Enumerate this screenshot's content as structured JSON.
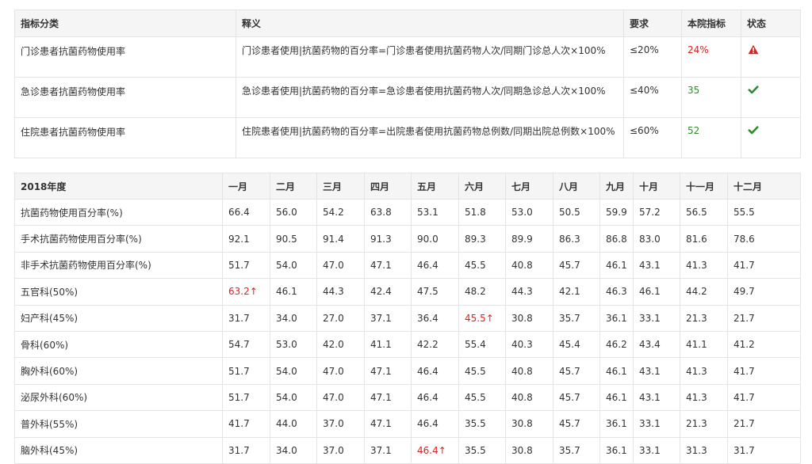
{
  "indicators": {
    "headers": {
      "category": "指标分类",
      "definition": "释义",
      "requirement": "要求",
      "value": "本院指标",
      "status": "状态"
    },
    "rows": [
      {
        "category": "门诊患者抗菌药物使用率",
        "definition": "门诊患者使用|抗菌药物的百分率=门诊患者使用抗菌药物人次/同期门诊总人次×100%",
        "requirement": "≤20%",
        "value": "24%",
        "value_color": "#e02020",
        "status_icon": "warning-icon"
      },
      {
        "category": "急诊患者抗菌药物使用率",
        "definition": "急诊患者使用|抗菌药物的百分率=急诊患者使用抗菌药物人次/同期急诊总人次×100%",
        "requirement": "≤40%",
        "value": "35",
        "value_color": "#2e8b2e",
        "status_icon": "checkmark-icon"
      },
      {
        "category": "住院患者抗菌药物使用率",
        "definition": "住院患者使用|抗菌药物的百分率=出院患者使用抗菌药物总例数/同期出院总例数×100%",
        "requirement": "≤60%",
        "value": "52",
        "value_color": "#2e8b2e",
        "status_icon": "checkmark-icon"
      }
    ]
  },
  "monthly": {
    "year_header": "2018年度",
    "months": [
      "一月",
      "二月",
      "三月",
      "四月",
      "五月",
      "六月",
      "七月",
      "八月",
      "九月",
      "十月",
      "十一月",
      "十二月"
    ],
    "rows": [
      {
        "label": "抗菌药物使用百分率(%)",
        "values": [
          "66.4",
          "56.0",
          "54.2",
          "63.8",
          "53.1",
          "51.8",
          "53.0",
          "50.5",
          "59.9",
          "57.2",
          "56.5",
          "55.5"
        ],
        "alerts": []
      },
      {
        "label": "手术抗菌药物使用百分率(%)",
        "values": [
          "92.1",
          "90.5",
          "91.4",
          "91.3",
          "90.0",
          "89.3",
          "89.9",
          "86.3",
          "86.8",
          "83.0",
          "81.6",
          "78.6"
        ],
        "alerts": []
      },
      {
        "label": "非手术抗菌药物使用百分率(%)",
        "values": [
          "51.7",
          "54.0",
          "47.0",
          "47.1",
          "46.4",
          "45.5",
          "40.8",
          "45.7",
          "46.1",
          "43.1",
          "41.3",
          "41.7"
        ],
        "alerts": []
      },
      {
        "label": "五官科(50%)",
        "values": [
          "63.2↑",
          "46.1",
          "44.3",
          "42.4",
          "47.5",
          "48.2",
          "44.3",
          "42.1",
          "46.3",
          "46.1",
          "44.2",
          "49.7"
        ],
        "alerts": [
          0
        ]
      },
      {
        "label": "妇产科(45%)",
        "values": [
          "31.7",
          "34.0",
          "27.0",
          "37.1",
          "36.4",
          "45.5↑",
          "30.8",
          "35.7",
          "36.1",
          "33.1",
          "21.3",
          "21.7"
        ],
        "alerts": [
          5
        ]
      },
      {
        "label": "骨科(60%)",
        "values": [
          "54.7",
          "53.0",
          "42.0",
          "41.1",
          "42.2",
          "55.4",
          "40.3",
          "45.4",
          "46.2",
          "43.4",
          "41.1",
          "41.2"
        ],
        "alerts": []
      },
      {
        "label": "胸外科(60%)",
        "values": [
          "51.7",
          "54.0",
          "47.0",
          "47.1",
          "46.4",
          "45.5",
          "40.8",
          "45.7",
          "46.1",
          "43.1",
          "41.3",
          "41.7"
        ],
        "alerts": []
      },
      {
        "label": "泌尿外科(60%)",
        "values": [
          "51.7",
          "54.0",
          "47.0",
          "47.1",
          "46.4",
          "45.5",
          "40.8",
          "45.7",
          "46.1",
          "43.1",
          "41.3",
          "41.7"
        ],
        "alerts": []
      },
      {
        "label": "普外科(55%)",
        "values": [
          "41.7",
          "44.0",
          "37.0",
          "47.1",
          "46.4",
          "35.5",
          "30.8",
          "45.7",
          "36.1",
          "33.1",
          "21.3",
          "21.7"
        ],
        "alerts": []
      },
      {
        "label": "脑外科(45%)",
        "values": [
          "31.7",
          "34.0",
          "37.0",
          "37.1",
          "46.4↑",
          "35.5",
          "30.8",
          "35.7",
          "36.1",
          "33.1",
          "31.3",
          "31.7"
        ],
        "alerts": [
          4
        ]
      }
    ]
  },
  "colors": {
    "alert_red": "#e02020",
    "ok_green": "#2e8b2e",
    "header_bg": "#f5f5f5",
    "border": "#e4e4e4"
  }
}
